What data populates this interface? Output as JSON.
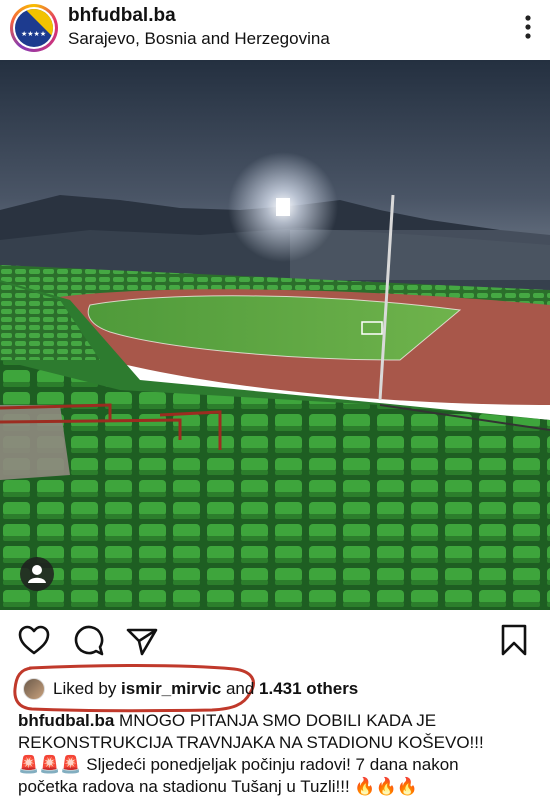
{
  "post": {
    "username": "bhfudbal.ba",
    "location": "Sarajevo, Bosnia and Herzegovina"
  },
  "icons": {
    "more": "more-horizontal-icon",
    "like": "heart-icon",
    "comment": "comment-icon",
    "share": "send-icon",
    "save": "bookmark-icon",
    "tag": "person-icon"
  },
  "likes": {
    "prefix": "Liked by ",
    "user": "ismir_mirvic",
    "middle": " and ",
    "count": "1.431 others"
  },
  "caption": {
    "username": "bhfudbal.ba",
    "line1": " MNOGO PITANJA SMO DOBILI KADA JE",
    "line2": "REKONSTRUKCIJA TRAVNJAKA NA STADIONU KOŠEVO!!!",
    "line3": "🚨🚨🚨 Sljedeći ponedjeljak počinju radovi! 7 dana nakon",
    "line4": "početka radova na stadionu Tušanj u Tuzli!!! 🔥🔥🔥"
  },
  "colors": {
    "annotation_red": "#c0392b",
    "seat_green": "#3a9a3a",
    "sky": "#3b4656"
  }
}
